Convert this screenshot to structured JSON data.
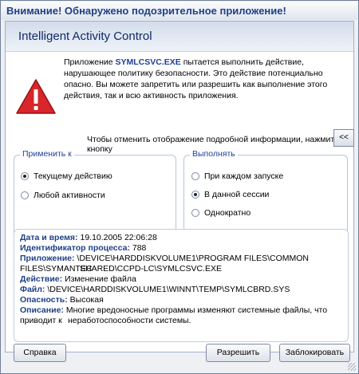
{
  "titlebar": {
    "title": "Внимание! Обнаружено подозрительное приложение!"
  },
  "header": {
    "title": "Intelligent Activity Control"
  },
  "message": {
    "prefix": "Приложение ",
    "app_name": "SYMLCSVC.EXE",
    "suffix": " пытается выполнить действие, нарушающее политику безопасности. Это действие потенциально опасно. Вы можете запретить или разрешить как выполнение этого действия, так и всю активность приложения."
  },
  "hint": {
    "text": "Чтобы отменить отображение подробной информации, нажмите на кнопку",
    "button": "<<"
  },
  "apply_group": {
    "legend": "Применить к",
    "options": [
      {
        "label": "Текущему действию",
        "checked": true
      },
      {
        "label": "Любой активности",
        "checked": false
      }
    ]
  },
  "execute_group": {
    "legend": "Выполнять",
    "options": [
      {
        "label": "При каждом запуске",
        "checked": false
      },
      {
        "label": "В данной сессии",
        "checked": true
      },
      {
        "label": "Однократно",
        "checked": false
      }
    ]
  },
  "details": {
    "datetime_label": "Дата и время:",
    "datetime_value": " 19.10.2005 22:06:28",
    "pid_label": "Идентификатор процесса:",
    "pid_value": " 788",
    "app_label": "Приложение:",
    "app_value_line1": " \\DEVICE\\HARDDISKVOLUME1\\PROGRAM FILES\\COMMON FILES\\SYMANTEC",
    "app_value_line2": "SHARED\\CCPD-LC\\SYMLCSVC.EXE",
    "action_label": "Действие:",
    "action_value": " Изменение файла",
    "file_label": "Файл:",
    "file_value": " \\DEVICE\\HARDDISKVOLUME1\\WINNT\\TEMP\\SYMLCBRD.SYS",
    "danger_label": "Опасность:",
    "danger_value": " Высокая",
    "desc_label": "Описание:",
    "desc_value_line1": " Многие вредоносные программы изменяют системные файлы, что приводит к",
    "desc_value_line2": "неработоспособности системы."
  },
  "buttons": {
    "help": "Справка",
    "allow": "Разрешить",
    "block": "Заблокировать"
  },
  "icons": {
    "warning": "warning-triangle-icon"
  },
  "colors": {
    "title_blue": "#1f3f86",
    "warning_red": "#d8262b"
  }
}
